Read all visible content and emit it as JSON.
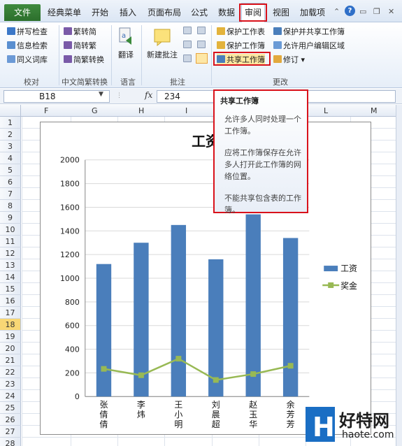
{
  "ribbon_tabs": {
    "file": "文件",
    "classic_menu": "经典菜单",
    "home": "开始",
    "insert": "插入",
    "page_layout": "页面布局",
    "formulas": "公式",
    "data": "数据",
    "review": "审阅",
    "view": "视图",
    "addins": "加载项"
  },
  "ribbon": {
    "proofing": {
      "spell_check": "拼写检查",
      "research": "信息检索",
      "thesaurus": "同义词库",
      "label": "校对"
    },
    "chinese": {
      "to_simplified": "繁转简",
      "to_traditional": "简转繁",
      "convert": "简繁转换",
      "label": "中文简繁转换"
    },
    "language": {
      "translate": "翻译",
      "label": "语言"
    },
    "comments": {
      "new_comment": "新建批注",
      "label": "批注"
    },
    "changes": {
      "protect_sheet": "保护工作表",
      "protect_workbook": "保护工作簿",
      "share_workbook": "共享工作簿",
      "protect_share": "保护并共享工作簿",
      "allow_edit": "允许用户编辑区域",
      "track": "修订",
      "label": "更改"
    }
  },
  "formula_bar": {
    "name_box": "B18",
    "fx": "fx",
    "value": "234"
  },
  "columns": [
    "F",
    "G",
    "H",
    "I",
    "J",
    "K",
    "L",
    "M"
  ],
  "rows": [
    "1",
    "2",
    "3",
    "4",
    "5",
    "6",
    "7",
    "8",
    "9",
    "10",
    "11",
    "12",
    "13",
    "14",
    "15",
    "16",
    "17",
    "18",
    "19",
    "20",
    "21",
    "22",
    "23",
    "24",
    "25",
    "26",
    "27",
    "28"
  ],
  "selected_row": "18",
  "tooltip": {
    "title": "共享工作簿",
    "p1": "允许多人同时处理一个工作簿。",
    "p2": "应将工作簿保存在允许多人打开此工作簿的网络位置。",
    "p3": "不能共享包含表的工作簿。"
  },
  "chart_data": {
    "type": "bar",
    "title": "工资",
    "categories": [
      "张倩倩",
      "李炜",
      "王小明",
      "刘晨超",
      "赵玉华",
      "余芳芳"
    ],
    "series": [
      {
        "name": "工资",
        "type": "bar",
        "values": [
          1120,
          1300,
          1450,
          1160,
          1540,
          1340
        ]
      },
      {
        "name": "奖金",
        "type": "line",
        "values": [
          234,
          180,
          320,
          140,
          190,
          260
        ]
      }
    ],
    "ylim": [
      0,
      2000
    ],
    "yticks": [
      "0",
      "200",
      "400",
      "600",
      "800",
      "1000",
      "1200",
      "1400",
      "1600",
      "1800",
      "2000"
    ],
    "legend_position": "right",
    "colors": {
      "bar": "#4a7ebb",
      "line": "#98b954"
    }
  },
  "watermark": {
    "brand": "好特网",
    "url": "haote.com"
  },
  "colors": {
    "highlight": "#d9121b",
    "file_tab": "#2c6f2c",
    "selected_row": "#f8d775"
  }
}
